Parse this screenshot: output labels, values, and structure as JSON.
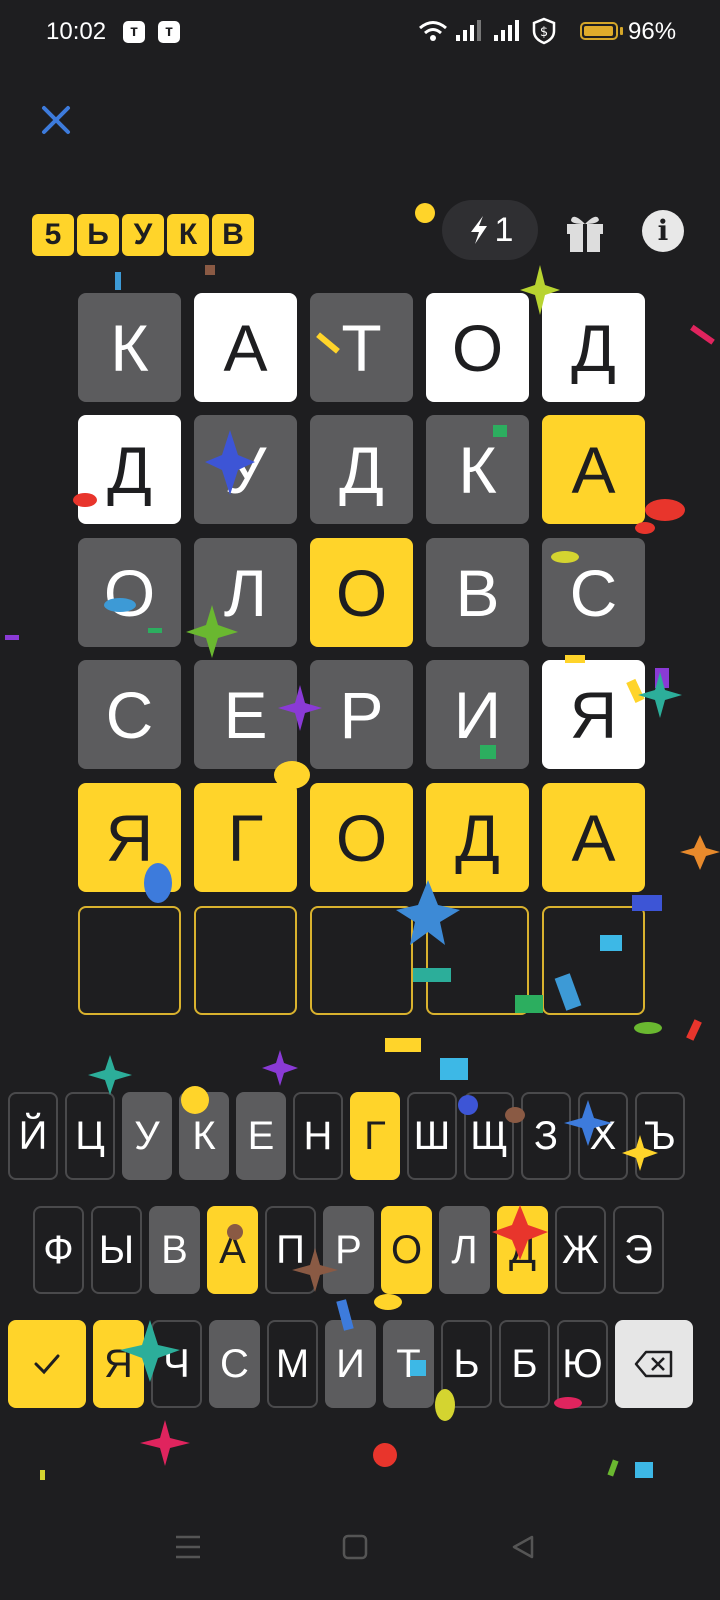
{
  "status": {
    "time": "10:02",
    "battery": "96%",
    "battery_level": 0.96
  },
  "logo_letters": [
    "5",
    "Ь",
    "У",
    "К",
    "В"
  ],
  "hints": {
    "count": "1"
  },
  "board": [
    [
      {
        "l": "К",
        "s": "absent"
      },
      {
        "l": "А",
        "s": "present"
      },
      {
        "l": "Т",
        "s": "absent"
      },
      {
        "l": "О",
        "s": "present"
      },
      {
        "l": "Д",
        "s": "present"
      }
    ],
    [
      {
        "l": "Д",
        "s": "present"
      },
      {
        "l": "У",
        "s": "absent"
      },
      {
        "l": "Д",
        "s": "absent"
      },
      {
        "l": "К",
        "s": "absent"
      },
      {
        "l": "А",
        "s": "correct"
      }
    ],
    [
      {
        "l": "О",
        "s": "absent"
      },
      {
        "l": "Л",
        "s": "absent"
      },
      {
        "l": "О",
        "s": "correct"
      },
      {
        "l": "В",
        "s": "absent"
      },
      {
        "l": "С",
        "s": "absent"
      }
    ],
    [
      {
        "l": "С",
        "s": "absent"
      },
      {
        "l": "Е",
        "s": "absent"
      },
      {
        "l": "Р",
        "s": "absent"
      },
      {
        "l": "И",
        "s": "absent"
      },
      {
        "l": "Я",
        "s": "present"
      }
    ],
    [
      {
        "l": "Я",
        "s": "correct"
      },
      {
        "l": "Г",
        "s": "correct"
      },
      {
        "l": "О",
        "s": "correct"
      },
      {
        "l": "Д",
        "s": "correct"
      },
      {
        "l": "А",
        "s": "correct"
      }
    ],
    [
      {
        "l": "",
        "s": "empty"
      },
      {
        "l": "",
        "s": "empty"
      },
      {
        "l": "",
        "s": "empty"
      },
      {
        "l": "",
        "s": "empty"
      },
      {
        "l": "",
        "s": "empty"
      }
    ]
  ],
  "keyboard": [
    [
      {
        "k": "Й",
        "s": "unused"
      },
      {
        "k": "Ц",
        "s": "unused"
      },
      {
        "k": "У",
        "s": "absent"
      },
      {
        "k": "К",
        "s": "absent"
      },
      {
        "k": "Е",
        "s": "absent"
      },
      {
        "k": "Н",
        "s": "unused"
      },
      {
        "k": "Г",
        "s": "correct"
      },
      {
        "k": "Ш",
        "s": "unused"
      },
      {
        "k": "Щ",
        "s": "unused"
      },
      {
        "k": "З",
        "s": "unused"
      },
      {
        "k": "Х",
        "s": "unused"
      },
      {
        "k": "Ъ",
        "s": "unused"
      }
    ],
    [
      {
        "k": "Ф",
        "s": "unused"
      },
      {
        "k": "Ы",
        "s": "unused"
      },
      {
        "k": "В",
        "s": "absent"
      },
      {
        "k": "А",
        "s": "correct"
      },
      {
        "k": "П",
        "s": "unused"
      },
      {
        "k": "Р",
        "s": "absent"
      },
      {
        "k": "О",
        "s": "correct"
      },
      {
        "k": "Л",
        "s": "absent"
      },
      {
        "k": "Д",
        "s": "correct"
      },
      {
        "k": "Ж",
        "s": "unused"
      },
      {
        "k": "Э",
        "s": "unused"
      }
    ],
    [
      {
        "k": "Я",
        "s": "correct"
      },
      {
        "k": "Ч",
        "s": "unused"
      },
      {
        "k": "С",
        "s": "absent"
      },
      {
        "k": "М",
        "s": "unused"
      },
      {
        "k": "И",
        "s": "absent"
      },
      {
        "k": "Т",
        "s": "absent"
      },
      {
        "k": "Ь",
        "s": "unused"
      },
      {
        "k": "Б",
        "s": "unused"
      },
      {
        "k": "Ю",
        "s": "unused"
      }
    ]
  ],
  "icons": {
    "close": "close-icon",
    "hint": "lightning-icon",
    "gift": "gift-icon",
    "info": "info-icon",
    "enter": "checkmark-icon",
    "backspace": "backspace-icon",
    "nav": [
      "menu-icon",
      "home-icon",
      "back-icon"
    ]
  },
  "colors": {
    "correct": "#ffd42a",
    "present": "#ffffff",
    "absent": "#5c5c5e",
    "background": "#1e1e20",
    "accent": "#3d7bdc"
  }
}
